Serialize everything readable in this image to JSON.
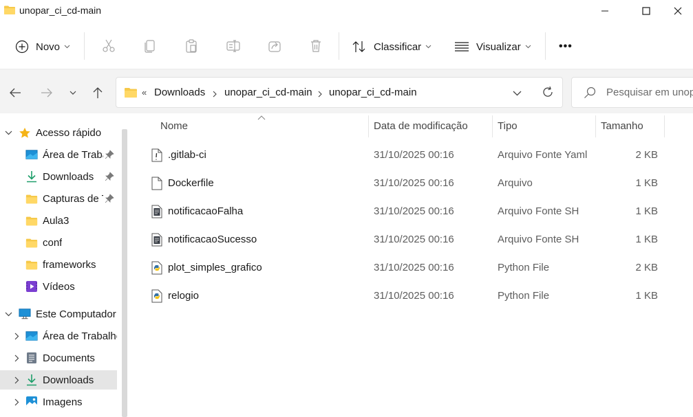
{
  "window": {
    "title": "unopar_ci_cd-main"
  },
  "toolbar": {
    "new_label": "Novo",
    "sort_label": "Classificar",
    "view_label": "Visualizar",
    "more_label": "•••"
  },
  "address": {
    "overflow": "«",
    "breadcrumbs": [
      "Downloads",
      "unopar_ci_cd-main",
      "unopar_ci_cd-main"
    ]
  },
  "search": {
    "placeholder": "Pesquisar em unop..."
  },
  "sidebar": {
    "quick_access": {
      "label": "Acesso rápido",
      "items": [
        {
          "label": "Área de Trabalho",
          "icon": "desktop-icon",
          "pinned": true
        },
        {
          "label": "Downloads",
          "icon": "download-icon",
          "pinned": true
        },
        {
          "label": "Capturas de Tela",
          "icon": "folder-icon",
          "pinned": true
        },
        {
          "label": "Aula3",
          "icon": "folder-icon",
          "pinned": false
        },
        {
          "label": "conf",
          "icon": "folder-icon",
          "pinned": false
        },
        {
          "label": "frameworks",
          "icon": "folder-icon",
          "pinned": false
        },
        {
          "label": "Vídeos",
          "icon": "video-icon",
          "pinned": false
        }
      ]
    },
    "this_pc": {
      "label": "Este Computador",
      "items": [
        {
          "label": "Área de Trabalho",
          "icon": "desktop-icon"
        },
        {
          "label": "Documents",
          "icon": "document-icon"
        },
        {
          "label": "Downloads",
          "icon": "download-icon",
          "selected": true
        },
        {
          "label": "Imagens",
          "icon": "image-icon"
        }
      ]
    }
  },
  "columns": {
    "name": "Nome",
    "date": "Data de modificação",
    "type": "Tipo",
    "size": "Tamanho"
  },
  "files": [
    {
      "name": ".gitlab-ci",
      "date": "31/10/2025 00:16",
      "type": "Arquivo Fonte Yaml",
      "size": "2 KB",
      "icon": "yaml-file-icon"
    },
    {
      "name": "Dockerfile",
      "date": "31/10/2025 00:16",
      "type": "Arquivo",
      "size": "1 KB",
      "icon": "blank-file-icon"
    },
    {
      "name": "notificacaoFalha",
      "date": "31/10/2025 00:16",
      "type": "Arquivo Fonte SH",
      "size": "1 KB",
      "icon": "shell-file-icon"
    },
    {
      "name": "notificacaoSucesso",
      "date": "31/10/2025 00:16",
      "type": "Arquivo Fonte SH",
      "size": "1 KB",
      "icon": "shell-file-icon"
    },
    {
      "name": "plot_simples_grafico",
      "date": "31/10/2025 00:16",
      "type": "Python File",
      "size": "2 KB",
      "icon": "python-file-icon"
    },
    {
      "name": "relogio",
      "date": "31/10/2025 00:16",
      "type": "Python File",
      "size": "1 KB",
      "icon": "python-file-icon"
    }
  ],
  "colors": {
    "folder": "#F6C94A",
    "accent": "#0067C0",
    "selected_row": "#E5E5E5"
  }
}
